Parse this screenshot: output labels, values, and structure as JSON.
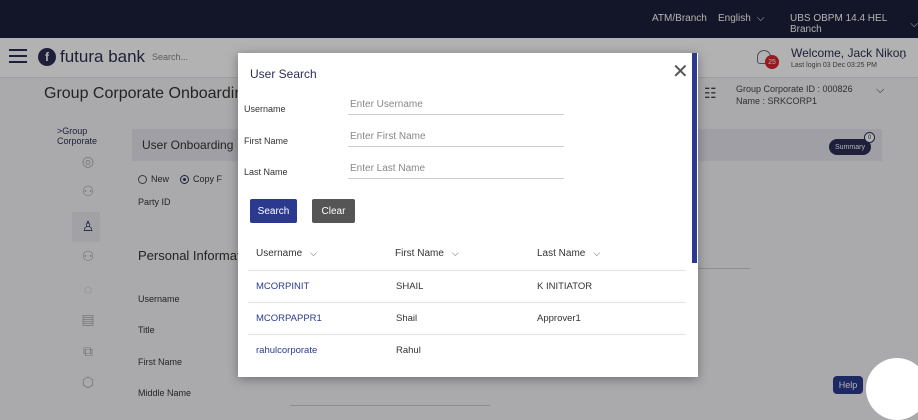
{
  "utility_bar": {
    "atm_branch": "ATM/Branch",
    "language": "English",
    "version": "UBS OBPM 14.4 HEL Branch"
  },
  "header": {
    "brand": "futura bank",
    "search_placeholder": "Search...",
    "notification_count": "25",
    "welcome": "Welcome, Jack Nikon",
    "last_login": "Last login 03 Dec 03:25 PM"
  },
  "page": {
    "title": "Group Corporate Onboarding",
    "group_corporate_id": "Group Corporate ID : 000826",
    "group_name": "Name : SRKCORP1"
  },
  "left_nav": {
    "back_label_line1": "Group",
    "back_label_line2": "Corporate"
  },
  "content": {
    "section_bar": "User Onboarding",
    "summary_label": "Summary",
    "summary_count": "0",
    "radio_new": "New",
    "radio_copy": "Copy F",
    "party_id_label": "Party ID",
    "personal_info": "Personal Informati",
    "fields": [
      "Username",
      "Title",
      "First Name",
      "Middle Name"
    ]
  },
  "modal": {
    "title": "User Search",
    "username_label": "Username",
    "username_placeholder": "Enter Username",
    "firstname_label": "First Name",
    "firstname_placeholder": "Enter First Name",
    "lastname_label": "Last Name",
    "lastname_placeholder": "Enter Last Name",
    "search_button": "Search",
    "clear_button": "Clear",
    "columns": [
      "Username",
      "First Name",
      "Last Name"
    ],
    "rows": [
      {
        "username": "MCORPINIT",
        "first_name": "SHAIL",
        "last_name": "K INITIATOR"
      },
      {
        "username": "MCORPAPPR1",
        "first_name": "Shail",
        "last_name": "Approver1"
      },
      {
        "username": "rahulcorporate",
        "first_name": "Rahul",
        "last_name": ""
      }
    ]
  },
  "help_label": "Help",
  "colors": {
    "primary": "#2b3a8f",
    "navy": "#2b2f55",
    "utility_bar": "#1c1f3a",
    "notification": "#d7262f"
  }
}
